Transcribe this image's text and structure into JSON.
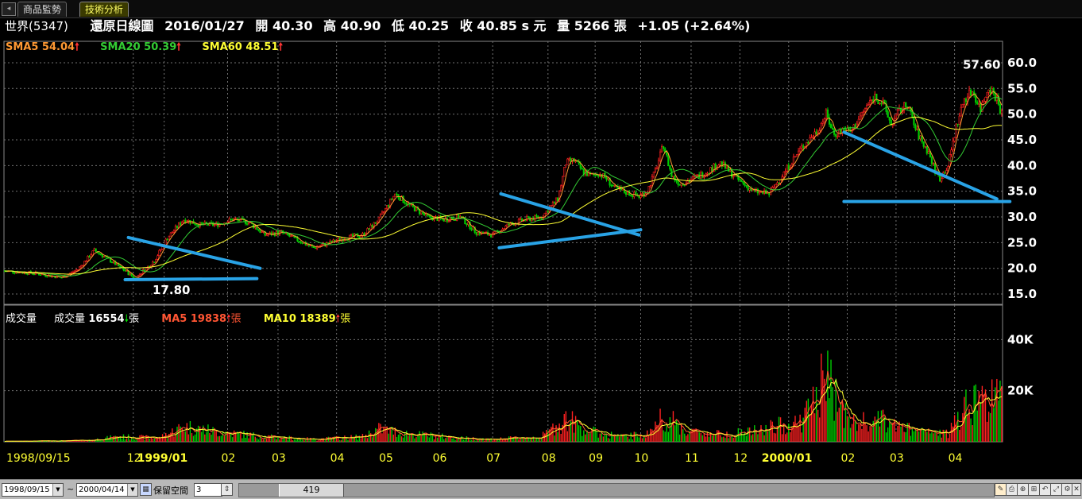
{
  "tabs": [
    {
      "label": "商品監勢"
    },
    {
      "label": "技術分析"
    }
  ],
  "header": {
    "stock": "世界(5347)",
    "mode": "還原日線圖",
    "date": "2016/01/27",
    "open": "開 40.30",
    "high": "高 40.90",
    "low": "低 40.25",
    "close": "收 40.85 s 元",
    "volume": "量 5266 張",
    "change": "+1.05 (+2.64%)"
  },
  "price_legend": {
    "sma5": "SMA5 54.04",
    "sma20": "SMA20 50.39",
    "sma60": "SMA60 48.51",
    "sma5_color": "#ff9933",
    "sma20_color": "#33cc33",
    "sma60_color": "#ffff33"
  },
  "volume_legend": {
    "title": "成交量",
    "vol_label": "成交量",
    "vol_value": "16554",
    "unit": "張",
    "ma5": "MA5 19838",
    "ma10": "MA10 18389",
    "ma5_color": "#ff5533",
    "ma10_color": "#ffff33"
  },
  "bottom_bar": {
    "start_date": "1998/09/15",
    "tilde": "~",
    "end_date": "2000/04/14",
    "keep_label": "保留空間",
    "keep_value": "3",
    "scroll_value": "419"
  },
  "chart_data": [
    {
      "type": "candlestick",
      "x_ticks": [
        "1998/09/15",
        "12",
        "1999/01",
        "02",
        "03",
        "04",
        "05",
        "06",
        "07",
        "08",
        "09",
        "10",
        "11",
        "12",
        "2000/01",
        "02",
        "03",
        "04"
      ],
      "ylim": [
        13,
        62
      ],
      "y_ticks": [
        15.0,
        20.0,
        25.0,
        30.0,
        35.0,
        40.0,
        45.0,
        50.0,
        55.0,
        60.0
      ],
      "y_tick_labels": [
        "15.0",
        "20.0",
        "25.0",
        "30.0",
        "35.0",
        "40.0",
        "45.0",
        "50.0",
        "55.0",
        "60.0"
      ],
      "annotations": [
        {
          "text": "17.80",
          "value": 17.8
        },
        {
          "text": "57.60",
          "value": 57.6
        }
      ],
      "price_path": [
        [
          0,
          19.5
        ],
        [
          20,
          19.0
        ],
        [
          35,
          18.2
        ],
        [
          45,
          19.8
        ],
        [
          55,
          23.5
        ],
        [
          65,
          21.5
        ],
        [
          75,
          19.3
        ],
        [
          80,
          18.0
        ],
        [
          85,
          19.5
        ],
        [
          92,
          21.5
        ],
        [
          100,
          26.0
        ],
        [
          110,
          29.5
        ],
        [
          120,
          28.5
        ],
        [
          130,
          28.5
        ],
        [
          140,
          29.5
        ],
        [
          150,
          29.0
        ],
        [
          160,
          26.5
        ],
        [
          170,
          27.0
        ],
        [
          180,
          25.5
        ],
        [
          190,
          24.0
        ],
        [
          200,
          25.0
        ],
        [
          210,
          26.0
        ],
        [
          220,
          26.5
        ],
        [
          230,
          29.5
        ],
        [
          240,
          34.5
        ],
        [
          250,
          32.0
        ],
        [
          260,
          30.0
        ],
        [
          270,
          29.5
        ],
        [
          280,
          30.0
        ],
        [
          285,
          28.5
        ],
        [
          290,
          27.0
        ],
        [
          300,
          26.5
        ],
        [
          310,
          28.5
        ],
        [
          320,
          29.5
        ],
        [
          330,
          30.0
        ],
        [
          340,
          33.5
        ],
        [
          345,
          40.5
        ],
        [
          350,
          41.0
        ],
        [
          355,
          39.0
        ],
        [
          360,
          38.0
        ],
        [
          365,
          38.5
        ],
        [
          370,
          37.5
        ],
        [
          375,
          35.5
        ],
        [
          380,
          35.0
        ],
        [
          390,
          34.0
        ],
        [
          395,
          35.0
        ],
        [
          400,
          39.0
        ],
        [
          405,
          44.0
        ],
        [
          410,
          38.0
        ],
        [
          415,
          36.5
        ],
        [
          420,
          37.0
        ],
        [
          430,
          38.5
        ],
        [
          440,
          40.5
        ],
        [
          450,
          37.5
        ],
        [
          460,
          35.0
        ],
        [
          470,
          34.5
        ],
        [
          480,
          39.0
        ],
        [
          490,
          43.5
        ],
        [
          500,
          47.0
        ],
        [
          505,
          50.0
        ],
        [
          510,
          46.0
        ],
        [
          515,
          47.0
        ],
        [
          520,
          46.5
        ],
        [
          530,
          51.5
        ],
        [
          535,
          53.5
        ],
        [
          540,
          52.0
        ],
        [
          545,
          48.0
        ],
        [
          550,
          50.5
        ],
        [
          555,
          52.0
        ],
        [
          560,
          47.0
        ],
        [
          565,
          44.0
        ],
        [
          568,
          42.5
        ],
        [
          572,
          39.0
        ],
        [
          575,
          37.5
        ],
        [
          580,
          40.0
        ],
        [
          585,
          47.5
        ],
        [
          590,
          53.0
        ],
        [
          595,
          54.5
        ],
        [
          600,
          51.0
        ],
        [
          605,
          55.5
        ],
        [
          610,
          53.0
        ],
        [
          613,
          50.0
        ]
      ],
      "volume_path": [
        [
          0,
          0.2
        ],
        [
          50,
          0.5
        ],
        [
          70,
          2.0
        ],
        [
          95,
          1.5
        ],
        [
          100,
          3.0
        ],
        [
          110,
          6.0
        ],
        [
          130,
          4.0
        ],
        [
          160,
          2.0
        ],
        [
          190,
          1.0
        ],
        [
          220,
          2.0
        ],
        [
          230,
          5.0
        ],
        [
          250,
          3.0
        ],
        [
          280,
          1.5
        ],
        [
          300,
          1.0
        ],
        [
          330,
          2.0
        ],
        [
          345,
          9.0
        ],
        [
          360,
          4.0
        ],
        [
          380,
          2.0
        ],
        [
          395,
          3.0
        ],
        [
          405,
          10.0
        ],
        [
          420,
          4.0
        ],
        [
          440,
          3.0
        ],
        [
          460,
          4.0
        ],
        [
          490,
          8.0
        ],
        [
          505,
          25.0
        ],
        [
          520,
          7.0
        ],
        [
          540,
          8.0
        ],
        [
          560,
          4.0
        ],
        [
          580,
          3.0
        ],
        [
          590,
          15.0
        ],
        [
          600,
          17.0
        ],
        [
          613,
          16.5
        ]
      ],
      "candle_count": 614,
      "max_price_shown": 57.6,
      "min_price_shown": 17.8
    },
    {
      "type": "bar",
      "y_ticks": [
        20000,
        40000
      ],
      "y_tick_labels": [
        "20K",
        "40K"
      ],
      "ylim": [
        0,
        51000
      ]
    }
  ],
  "colors": {
    "up": "#ff2020",
    "down": "#00cc00",
    "grid": "#707070",
    "axis_text": "#ffff33",
    "trendline": "#29a3e6"
  }
}
